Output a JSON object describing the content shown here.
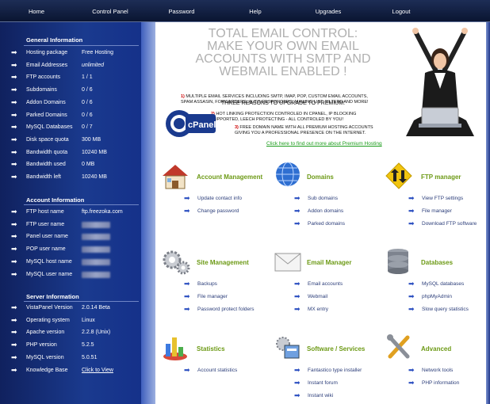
{
  "nav": [
    "Home",
    "Control Panel",
    "Password",
    "Help",
    "Upgrades",
    "Logout"
  ],
  "general": {
    "title": "General Information",
    "rows": [
      {
        "label": "Hosting package",
        "value": "Free Hosting"
      },
      {
        "label": "Email Addresses",
        "value": "unlimited"
      },
      {
        "label": "FTP accounts",
        "value": "1 / 1"
      },
      {
        "label": "Subdomains",
        "value": "0 / 6"
      },
      {
        "label": "Addon Domains",
        "value": "0 / 6"
      },
      {
        "label": "Parked Domains",
        "value": "0 / 6"
      },
      {
        "label": "MySQL Databases",
        "value": "0 / 7"
      },
      {
        "label": "Disk space quota",
        "value": "300 MB"
      },
      {
        "label": "Bandwidth quota",
        "value": "10240 MB"
      },
      {
        "label": "Bandwidth used",
        "value": "0 MB"
      },
      {
        "label": "Bandwidth left",
        "value": "10240 MB"
      }
    ]
  },
  "account": {
    "title": "Account Information",
    "rows": [
      {
        "label": "FTP host name",
        "value": "ftp.freezoka.com"
      },
      {
        "label": "FTP user name",
        "value": ""
      },
      {
        "label": "Panel user name",
        "value": ""
      },
      {
        "label": "POP user name",
        "value": ""
      },
      {
        "label": "MySQL host name",
        "value": ""
      },
      {
        "label": "MySQL user name",
        "value": ""
      }
    ]
  },
  "server": {
    "title": "Server Information",
    "rows": [
      {
        "label": "VistaPanel Version",
        "value": "2.0.14 Beta"
      },
      {
        "label": "Operating system",
        "value": "Linux"
      },
      {
        "label": "Apache version",
        "value": "2.2.8 (Unix)"
      },
      {
        "label": "PHP version",
        "value": "5.2.5"
      },
      {
        "label": "MySQL version",
        "value": "5.0.51"
      },
      {
        "label": "Knowledge Base",
        "value": "Click to View"
      }
    ]
  },
  "promo": {
    "headline": [
      "TOTAL EMAIL CONTROL:",
      "MAKE YOUR OWN EMAIL",
      "ACCOUNTS WITH SMTP AND",
      "WEBMAIL ENABLED !"
    ],
    "reasons_title": "THREE REASONS TO UPGRADE TO PREMIUM:",
    "reason1_num": "1)",
    "reason1": "MULTIPLE EMAIL SERVICES INCLUDING SMTP, IMAP, POP, CUSTOM EMAIL ACCOUNTS, SPAM ASSASIN, FORWARDERS, AUTO RESPONDERS, MAILING LIST, FILTERS AND MORE!",
    "reason2_num": "2)",
    "reason2": "HOT LINKING PROTECTION CONTROLED IN CPANEL, IP BLOCKING SUPPORTED, LEECH PROTECTING - ALL CONTROLED BY YOU!",
    "reason3_num": "3)",
    "reason3": "FREE DOMAIN NAME WITH ALL PREMIUM HOSTING ACCOUNTS GIVING YOU A PROFESSIONAL PRESENCE ON THE INTERNET.",
    "logo_text": "cPanel",
    "link": "Click here to find out more about Premium Hosting"
  },
  "categories": [
    {
      "title": "Account Management",
      "icon": "house-icon",
      "items": [
        "Update contact info",
        "Change password"
      ]
    },
    {
      "title": "Domains",
      "icon": "globe-icon",
      "items": [
        "Sub domains",
        "Addon domains",
        "Parked domains"
      ]
    },
    {
      "title": "FTP manager",
      "icon": "transfer-arrows-icon",
      "items": [
        "View FTP settings",
        "File manager",
        "Download FTP software"
      ]
    },
    {
      "title": "Site Management",
      "icon": "gears-icon",
      "items": [
        "Backups",
        "File manager",
        "Password protect folders"
      ]
    },
    {
      "title": "Email Manager",
      "icon": "envelope-icon",
      "items": [
        "Email accounts",
        "Webmail",
        "MX entry"
      ]
    },
    {
      "title": "Databases",
      "icon": "database-icon",
      "items": [
        "MySQL databases",
        "phpMyAdmin",
        "Slow query statistics"
      ]
    },
    {
      "title": "Statistics",
      "icon": "bar-chart-icon",
      "items": [
        "Account statistics"
      ]
    },
    {
      "title": "Software / Services",
      "icon": "software-box-icon",
      "items": [
        "Fantastico type installer",
        "Instant forum",
        "Instant wiki"
      ]
    },
    {
      "title": "Advanced",
      "icon": "tools-icon",
      "items": [
        "Network tools",
        "PHP information"
      ]
    }
  ],
  "colors": {
    "accent_green": "#6d9a16",
    "sidebar_blue": "#15318a",
    "link_blue": "#2c3e7a"
  }
}
